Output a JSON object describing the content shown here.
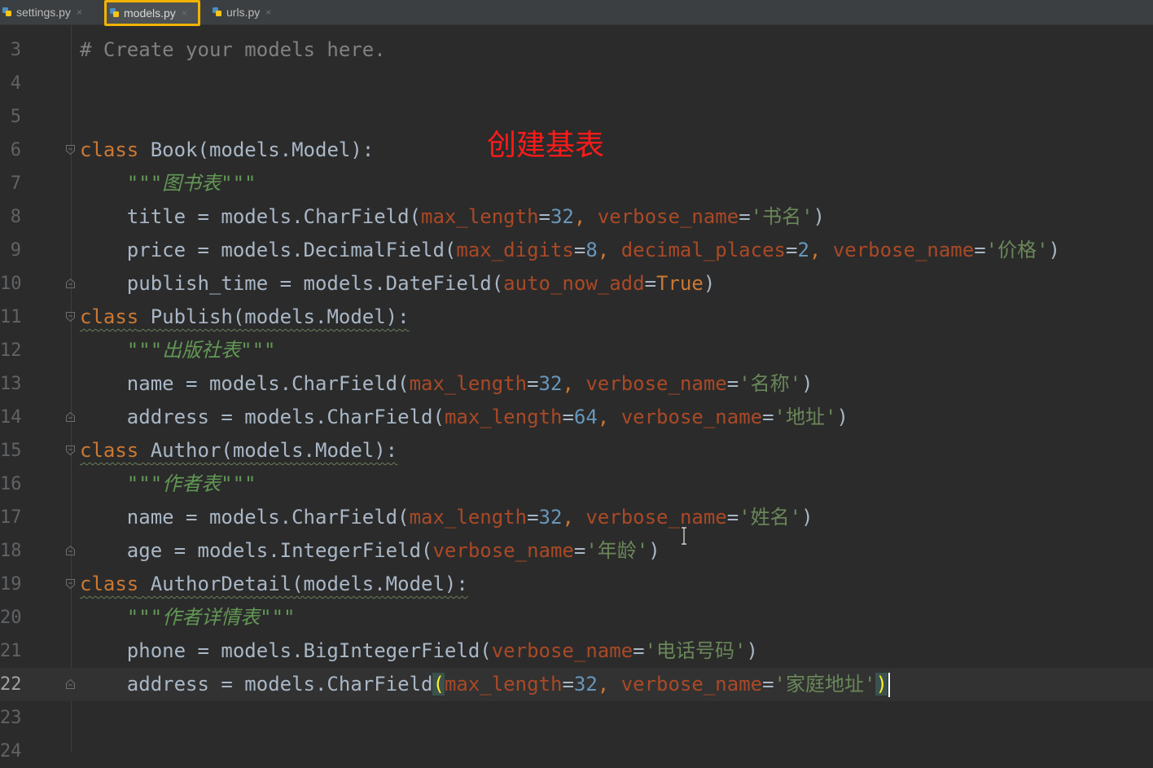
{
  "tabs": [
    {
      "label": "settings.py",
      "icon": "python-file-icon"
    },
    {
      "label": "models.py",
      "icon": "python-file-icon",
      "active": true
    },
    {
      "label": "urls.py",
      "icon": "python-file-icon"
    }
  ],
  "tab_close_glyph": "×",
  "annotation": "创建基表",
  "current_line": 22,
  "lines": [
    {
      "n": "3",
      "segments": [
        {
          "t": "# Create your models here.",
          "c": "comment"
        }
      ]
    },
    {
      "n": "4",
      "segments": []
    },
    {
      "n": "5",
      "segments": []
    },
    {
      "n": "6",
      "fold": "open",
      "segments": [
        {
          "t": "class",
          "c": "kw"
        },
        {
          "t": " Book(models.Model):"
        }
      ]
    },
    {
      "n": "7",
      "segments": [
        {
          "t": "    \"\"\"图书表\"\"\"",
          "c": "doc"
        }
      ]
    },
    {
      "n": "8",
      "segments": [
        {
          "t": "    title = models.CharField("
        },
        {
          "t": "max_length",
          "c": "param"
        },
        {
          "t": "="
        },
        {
          "t": "32",
          "c": "num"
        },
        {
          "t": ", ",
          "c": "kw"
        },
        {
          "t": "verbose_name",
          "c": "param"
        },
        {
          "t": "="
        },
        {
          "t": "'书名'",
          "c": "str"
        },
        {
          "t": ")"
        }
      ]
    },
    {
      "n": "9",
      "segments": [
        {
          "t": "    price = models.DecimalField("
        },
        {
          "t": "max_digits",
          "c": "param"
        },
        {
          "t": "="
        },
        {
          "t": "8",
          "c": "num"
        },
        {
          "t": ", ",
          "c": "kw"
        },
        {
          "t": "decimal_places",
          "c": "param"
        },
        {
          "t": "="
        },
        {
          "t": "2",
          "c": "num"
        },
        {
          "t": ", ",
          "c": "kw"
        },
        {
          "t": "verbose_name",
          "c": "param"
        },
        {
          "t": "="
        },
        {
          "t": "'价格'",
          "c": "str"
        },
        {
          "t": ")"
        }
      ]
    },
    {
      "n": "10",
      "fold": "close",
      "segments": [
        {
          "t": "    publish_time = models.DateField("
        },
        {
          "t": "auto_now_add",
          "c": "param"
        },
        {
          "t": "="
        },
        {
          "t": "True",
          "c": "kw"
        },
        {
          "t": ")"
        }
      ]
    },
    {
      "n": "11",
      "fold": "open",
      "squiggle": true,
      "segments": [
        {
          "t": "class",
          "c": "kw"
        },
        {
          "t": " Publish(models.Model):"
        }
      ]
    },
    {
      "n": "12",
      "segments": [
        {
          "t": "    \"\"\"出版社表\"\"\"",
          "c": "doc"
        }
      ]
    },
    {
      "n": "13",
      "segments": [
        {
          "t": "    name = models.CharField("
        },
        {
          "t": "max_length",
          "c": "param"
        },
        {
          "t": "="
        },
        {
          "t": "32",
          "c": "num"
        },
        {
          "t": ", ",
          "c": "kw"
        },
        {
          "t": "verbose_name",
          "c": "param"
        },
        {
          "t": "="
        },
        {
          "t": "'名称'",
          "c": "str"
        },
        {
          "t": ")"
        }
      ]
    },
    {
      "n": "14",
      "fold": "close",
      "segments": [
        {
          "t": "    address = models.CharField("
        },
        {
          "t": "max_length",
          "c": "param"
        },
        {
          "t": "="
        },
        {
          "t": "64",
          "c": "num"
        },
        {
          "t": ", ",
          "c": "kw"
        },
        {
          "t": "verbose_name",
          "c": "param"
        },
        {
          "t": "="
        },
        {
          "t": "'地址'",
          "c": "str"
        },
        {
          "t": ")"
        }
      ]
    },
    {
      "n": "15",
      "fold": "open",
      "squiggle": true,
      "segments": [
        {
          "t": "class",
          "c": "kw"
        },
        {
          "t": " Author(models.Model):"
        }
      ]
    },
    {
      "n": "16",
      "segments": [
        {
          "t": "    \"\"\"作者表\"\"\"",
          "c": "doc"
        }
      ]
    },
    {
      "n": "17",
      "segments": [
        {
          "t": "    name = models.CharField("
        },
        {
          "t": "max_length",
          "c": "param"
        },
        {
          "t": "="
        },
        {
          "t": "32",
          "c": "num"
        },
        {
          "t": ", ",
          "c": "kw"
        },
        {
          "t": "verbose_name",
          "c": "param"
        },
        {
          "t": "="
        },
        {
          "t": "'姓名'",
          "c": "str"
        },
        {
          "t": ")"
        }
      ]
    },
    {
      "n": "18",
      "fold": "close",
      "segments": [
        {
          "t": "    age = models.IntegerField("
        },
        {
          "t": "verbose_name",
          "c": "param"
        },
        {
          "t": "="
        },
        {
          "t": "'年龄'",
          "c": "str"
        },
        {
          "t": ")"
        }
      ]
    },
    {
      "n": "19",
      "fold": "open",
      "squiggle": true,
      "segments": [
        {
          "t": "class",
          "c": "kw"
        },
        {
          "t": " AuthorDetail(models.Model):"
        }
      ]
    },
    {
      "n": "20",
      "segments": [
        {
          "t": "    \"\"\"作者详情表\"\"\"",
          "c": "doc"
        }
      ]
    },
    {
      "n": "21",
      "segments": [
        {
          "t": "    phone = models.BigIntegerField("
        },
        {
          "t": "verbose_name",
          "c": "param"
        },
        {
          "t": "="
        },
        {
          "t": "'电话号码'",
          "c": "str"
        },
        {
          "t": ")"
        }
      ]
    },
    {
      "n": "22",
      "fold": "close",
      "segments": [
        {
          "t": "    address = models.CharField"
        },
        {
          "t": "(",
          "c": "brace-hl"
        },
        {
          "t": "max_length",
          "c": "param"
        },
        {
          "t": "="
        },
        {
          "t": "32",
          "c": "num"
        },
        {
          "t": ", ",
          "c": "kw"
        },
        {
          "t": "verbose_name",
          "c": "param"
        },
        {
          "t": "="
        },
        {
          "t": "'家庭地址'",
          "c": "str"
        },
        {
          "t": ")",
          "c": "brace-hl"
        },
        {
          "caret": true
        }
      ]
    },
    {
      "n": "23",
      "segments": []
    },
    {
      "n": "24",
      "segments": []
    }
  ]
}
